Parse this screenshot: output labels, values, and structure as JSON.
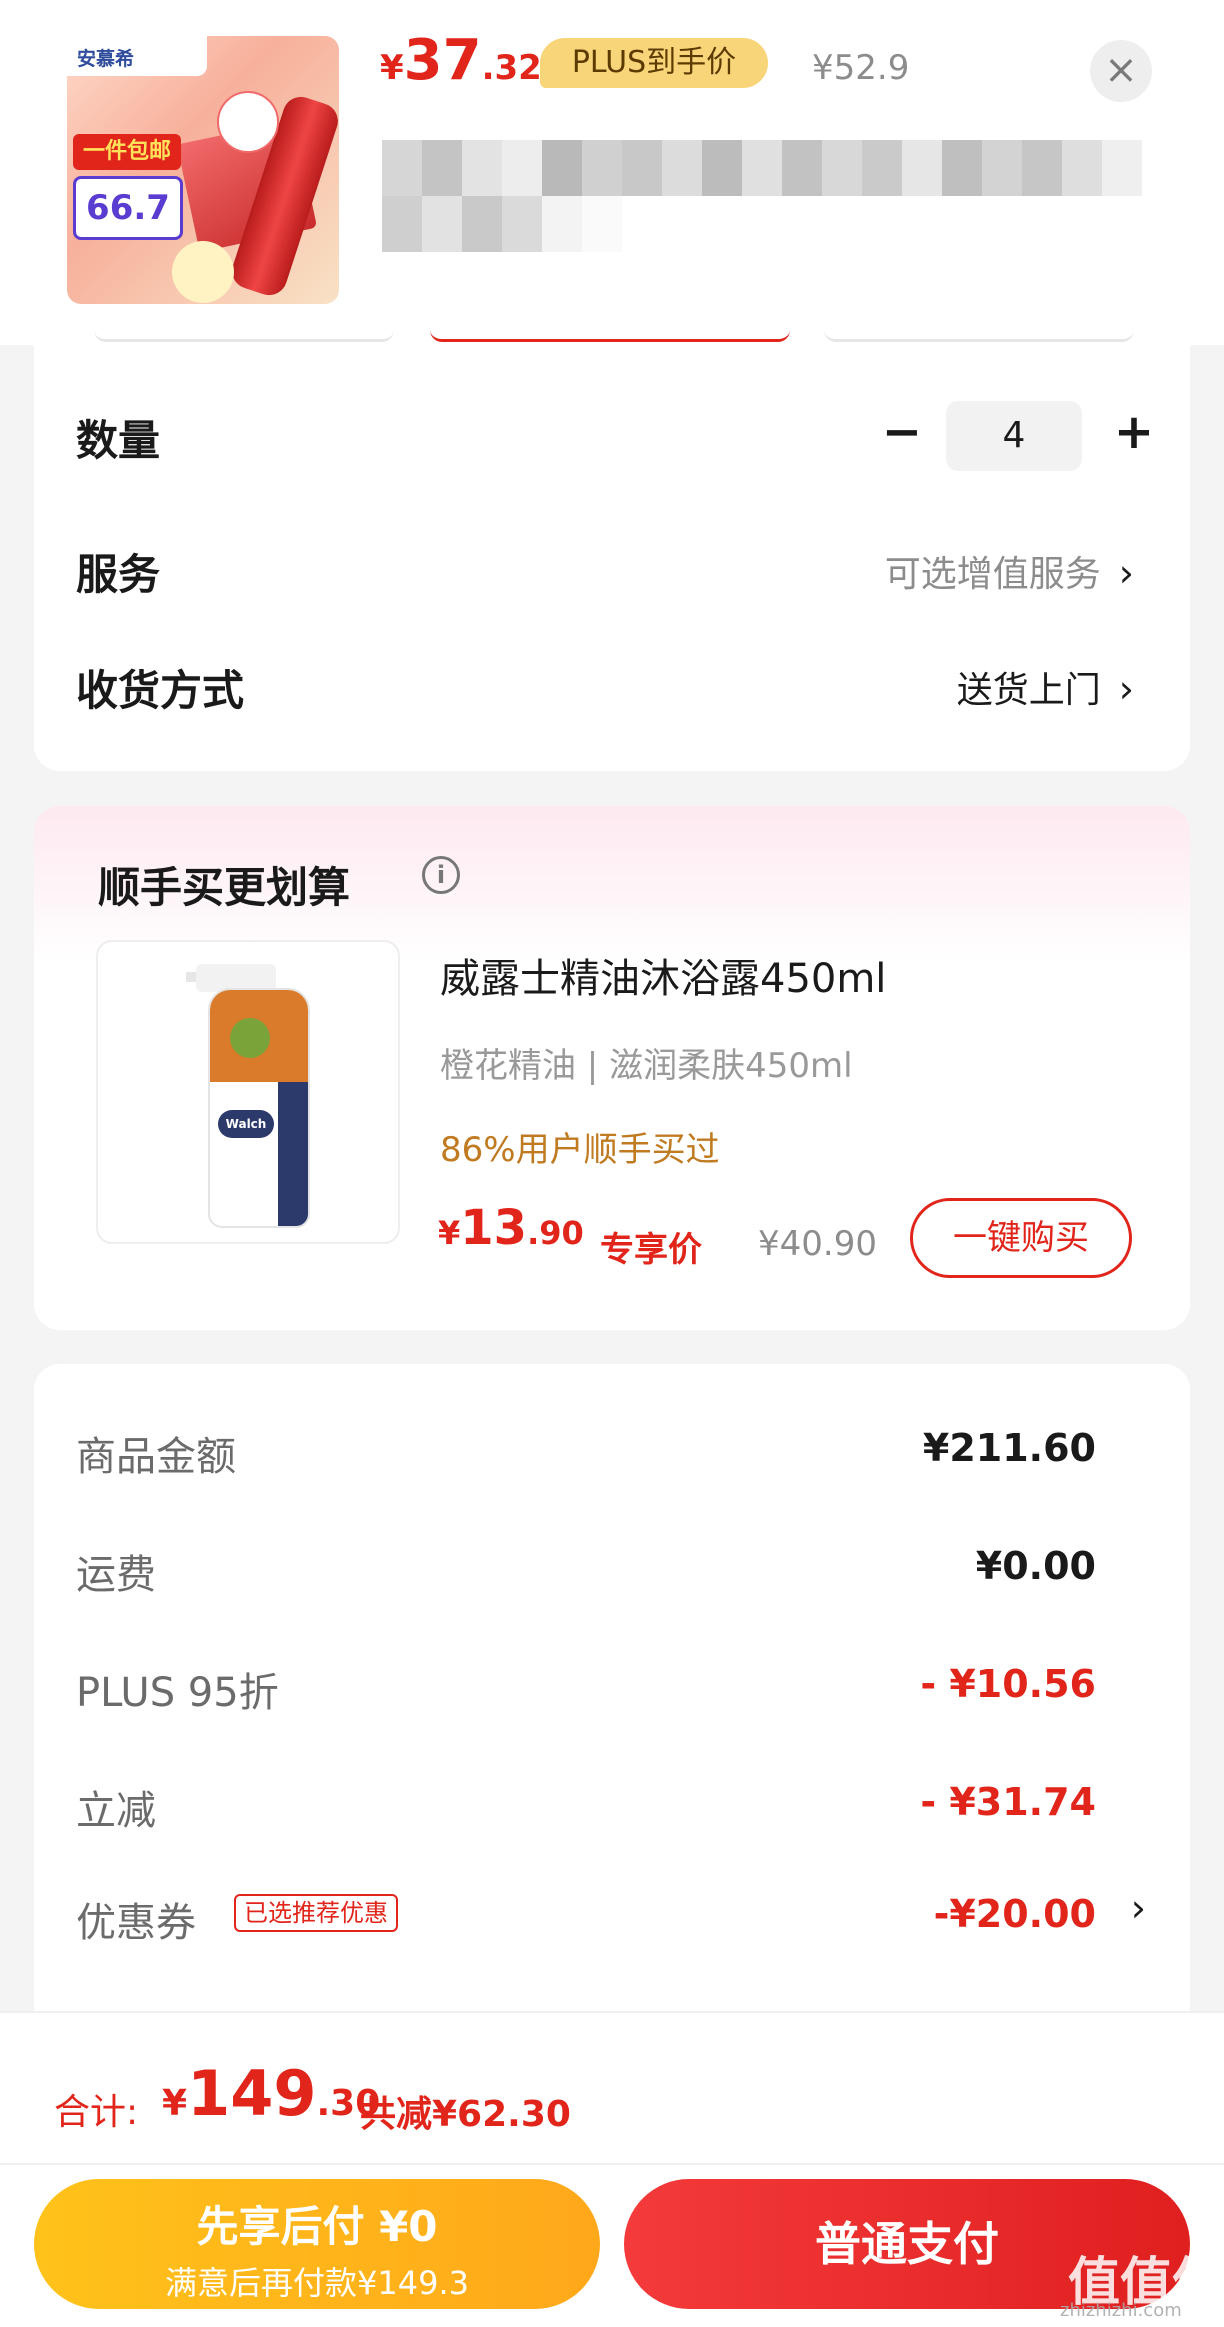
{
  "header": {
    "thumb": {
      "brand": "安慕希",
      "banner": "一件包邮",
      "price": "66.7"
    },
    "price": {
      "symbol": "¥",
      "integer": "37",
      "decimal": ".32"
    },
    "plus_tag": "PLUS到手价",
    "original_price": "¥52.9",
    "close_label": "×"
  },
  "options": {
    "quantity": {
      "label": "数量",
      "minus": "−",
      "value": "4",
      "plus": "+"
    },
    "service": {
      "label": "服务",
      "value": "可选增值服务",
      "chevron": "›"
    },
    "delivery": {
      "label": "收货方式",
      "value": "送货上门",
      "chevron": "›"
    }
  },
  "recommendation": {
    "title": "顺手买更划算",
    "info_icon": "i",
    "product": {
      "name": "威露士精油沐浴露450ml",
      "spec": "橙花精油 | 滋润柔肤450ml",
      "stat": "86%用户顺手买过",
      "price": {
        "symbol": "¥",
        "integer": "13",
        "decimal": ".90"
      },
      "exclusive_label": "专享价",
      "original_price": "¥40.90",
      "buy_button": "一键购买",
      "thumb_brand": "Walch"
    }
  },
  "cost_summary": {
    "items": [
      {
        "label": "商品金额",
        "value": "¥211.60",
        "highlight": false
      },
      {
        "label": "运费",
        "value": "¥0.00",
        "highlight": false
      },
      {
        "label": "PLUS 95折",
        "value": "- ¥10.56",
        "highlight": true
      },
      {
        "label": "立减",
        "value": "- ¥31.74",
        "highlight": true
      },
      {
        "label": "优惠券",
        "value": "-¥20.00",
        "highlight": true
      }
    ],
    "coupon_tag": "已选推荐优惠",
    "coupon_chevron": "›"
  },
  "bottom_bar": {
    "total_label": "合计:",
    "total": {
      "symbol": "¥",
      "integer": "149",
      "decimal": ".30"
    },
    "saved": "共减¥62.30",
    "pay_later": {
      "title": "先享后付 ¥0",
      "subtitle": "满意后再付款¥149.3"
    },
    "pay_normal": "普通支付"
  },
  "watermark": {
    "main": "值值值",
    "sub": "zhizhizhi.com"
  },
  "colors": {
    "accent_red": "#e1251b",
    "plus_gold": "#f9d57a",
    "pay_later_yellow": "#ffb81a",
    "stat_orange": "#c07a20"
  }
}
